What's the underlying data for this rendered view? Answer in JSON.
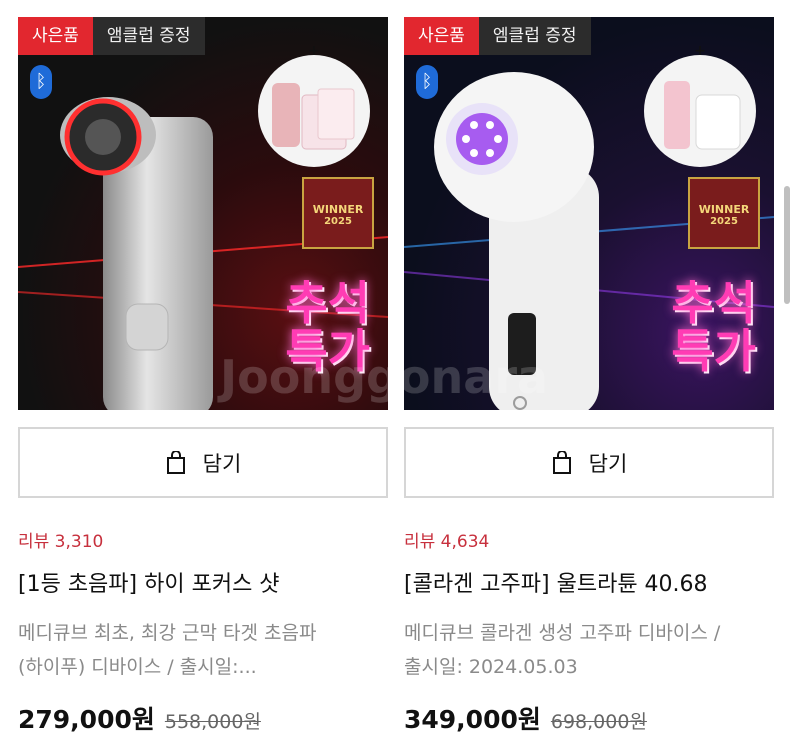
{
  "watermark": "Joonggonara",
  "products": [
    {
      "badges": [
        "사은품",
        "앰클럽 증정"
      ],
      "winner": [
        "WINNER",
        "2025"
      ],
      "promo": [
        "추석",
        "특가"
      ],
      "cart_label": "담기",
      "review": "리뷰 3,310",
      "title": "[1등 초음파] 하이 포커스 샷",
      "desc_line1": "메디큐브 최초, 최강 근막 타겟 초음파",
      "desc_line2": "(하이푸) 디바이스 / 출시일:...",
      "price": "279,000원",
      "original_price": "558,000원",
      "accent_color": "#e2272f"
    },
    {
      "badges": [
        "사은품",
        "엠클럽 증정"
      ],
      "winner": [
        "WINNER",
        "2025"
      ],
      "promo": [
        "추석",
        "특가"
      ],
      "cart_label": "담기",
      "review": "리뷰 4,634",
      "title": "[콜라겐 고주파] 울트라튠 40.68",
      "desc_line1": "메디큐브 콜라겐 생성 고주파 디바이스 /",
      "desc_line2": "출시일: 2024.05.03",
      "price": "349,000원",
      "original_price": "698,000원",
      "accent_color": "#e2272f"
    }
  ]
}
